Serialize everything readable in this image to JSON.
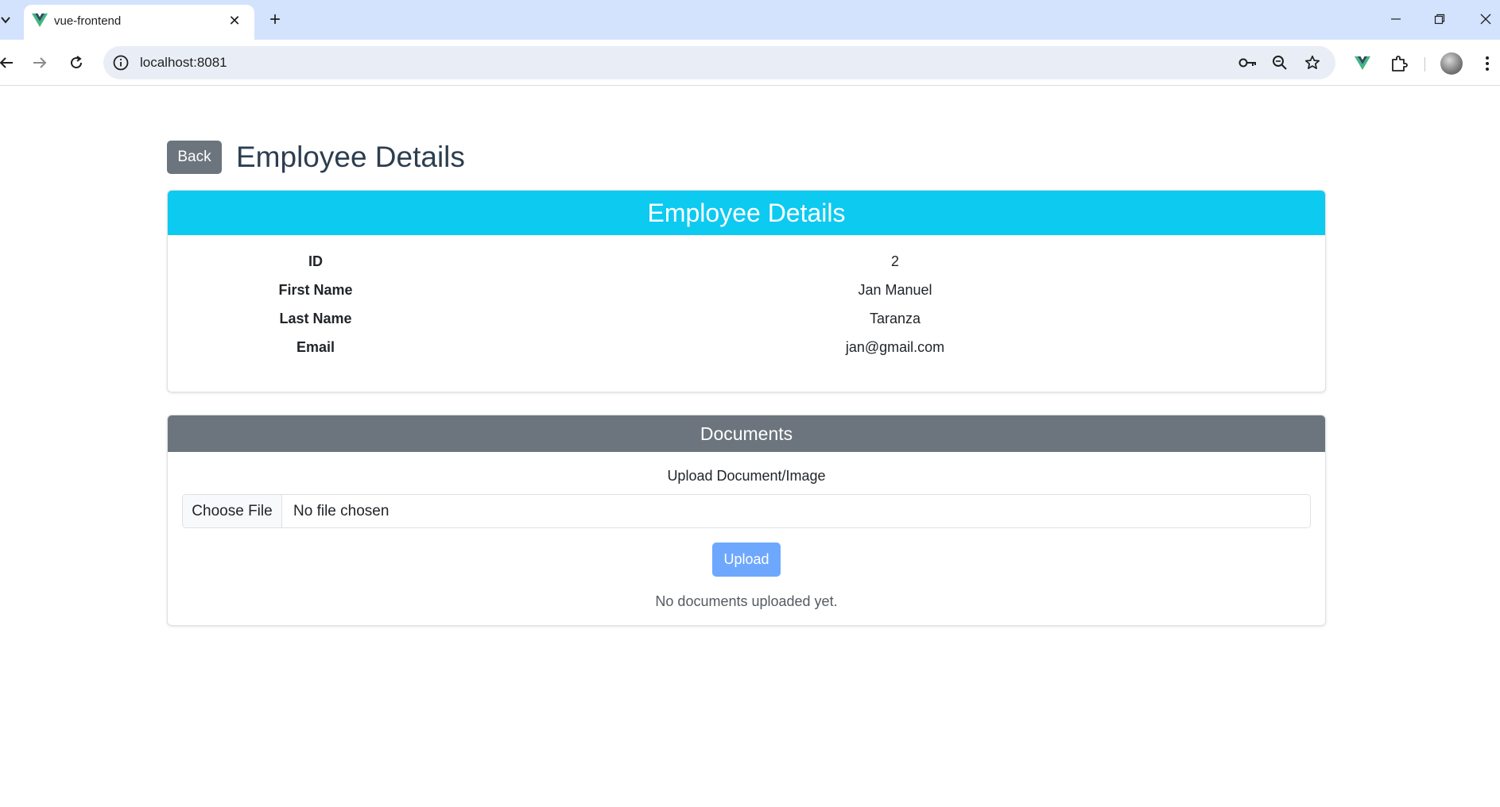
{
  "browser": {
    "tab_title": "vue-frontend",
    "url": "localhost:8081",
    "accent": "#d3e3fd"
  },
  "page": {
    "back_label": "Back",
    "title": "Employee Details"
  },
  "details_card": {
    "header": "Employee Details",
    "header_color": "#0dcaf0",
    "rows": [
      {
        "label": "ID",
        "value": "2"
      },
      {
        "label": "First Name",
        "value": "Jan Manuel"
      },
      {
        "label": "Last Name",
        "value": "Taranza"
      },
      {
        "label": "Email",
        "value": "jan@gmail.com"
      }
    ]
  },
  "documents_card": {
    "header": "Documents",
    "header_color": "#6c757d",
    "upload_label": "Upload Document/Image",
    "choose_file_label": "Choose File",
    "file_status": "No file chosen",
    "upload_button": "Upload",
    "empty_message": "No documents uploaded yet."
  }
}
